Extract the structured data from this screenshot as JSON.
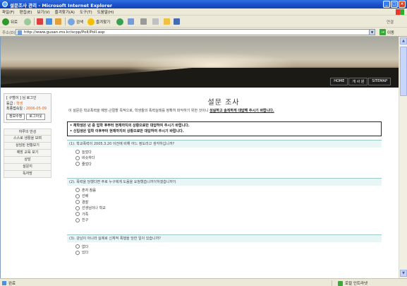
{
  "window": {
    "title": "설문조사 관리 - Microsoft Internet Explorer",
    "controls": [
      "_",
      "□",
      "×"
    ]
  },
  "menubar": {
    "items": [
      "파일(F)",
      "편집(E)",
      "보기(V)",
      "즐겨찾기(A)",
      "도구(T)",
      "도움말(H)"
    ]
  },
  "toolbar": {
    "back": "뒤로",
    "search": "검색",
    "favorites": "즐겨찾기",
    "links": "연결"
  },
  "address": {
    "label": "주소(D)",
    "url": "http://www.gusan.ms.kr/scpp/Poll/Poll.asp",
    "go": "이동"
  },
  "banner": {
    "nav": [
      "HOME",
      "개 사 원",
      "SITEMAP"
    ]
  },
  "sidebar": {
    "user_name": "[ 구범이 ] 님 로그인",
    "grade_label": "등급 : ",
    "grade_value": "학생",
    "last_login_label": "최종접속일 : ",
    "last_login_value": "2006-05-09",
    "edit_info": "정보수정",
    "logout": "로그아웃",
    "menu": [
      "하루의 반성",
      "스스로 생활을 보며",
      "상담된 현황보기",
      "예방 교육 보기",
      "상담",
      "설문지",
      "독자방"
    ]
  },
  "main": {
    "title": "설문 조사",
    "intro_plain": "이 설문은 학교폭력을 예방·근절할 목적으로, 학생들의 폭력실태를 정확히 파악하기 위한 것이니 ",
    "intro_bold": "성실하고 솔직하게 대답해 주시기 바랍니다.",
    "notice_1": "• 재학생은 년 중 입학 후부터 현재까지의 상황으로만 대답하여 주시기 바랍니다.",
    "notice_2": "• 신입생은 입학 이후부터 현재까지의 상황으로만 대답하여 주시기 바랍니다.",
    "questions": [
      {
        "text": "(1). 학교폭력이 2005.3.20 이전에 비해 어느 정도라고 생각하십니까?",
        "options": [
          "늘었다",
          "비슷하다",
          "줄었다"
        ]
      },
      {
        "text": "(2). 폭력을 당했다면 주로 누구에게 도움을 요청했습니까?(하겠습니까?)",
        "options": [
          "혼자 참음",
          "선배",
          "경찰",
          "선생님이나 학교",
          "가족",
          "친구"
        ]
      },
      {
        "text": "(3). 강남이 아니라 실제로 신체적 폭행을 당한 일이 있습니까?",
        "options": [
          "없다",
          "있다"
        ]
      }
    ]
  },
  "statusbar": {
    "left": "완료",
    "right": "로컬 인트라넷"
  }
}
